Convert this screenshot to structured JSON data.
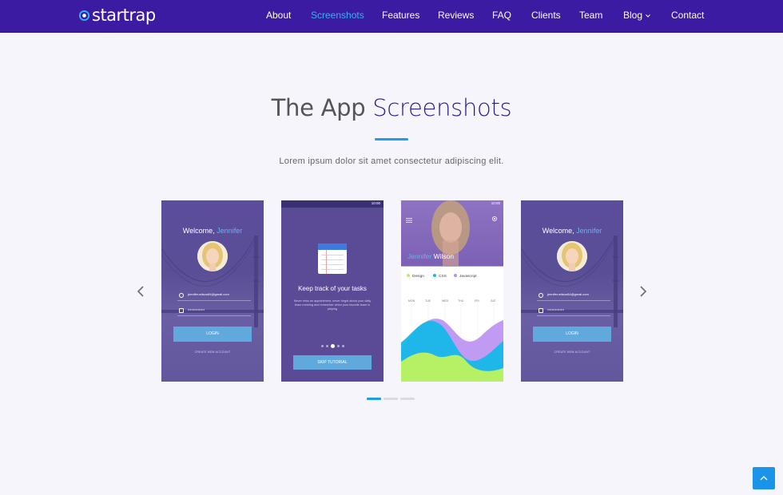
{
  "brand": {
    "name": "startrap",
    "accent": "#3b1ba2",
    "link_active": "#2fb5f0",
    "highlight": "#1a9fe8"
  },
  "nav": {
    "items": [
      {
        "label": "About",
        "active": false
      },
      {
        "label": "Screenshots",
        "active": true
      },
      {
        "label": "Features",
        "active": false
      },
      {
        "label": "Reviews",
        "active": false
      },
      {
        "label": "FAQ",
        "active": false
      },
      {
        "label": "Clients",
        "active": false
      },
      {
        "label": "Team",
        "active": false
      },
      {
        "label": "Blog",
        "active": false,
        "dropdown": true
      },
      {
        "label": "Contact",
        "active": false
      }
    ]
  },
  "section": {
    "title_light": "The App",
    "title_strong": "Screenshots",
    "subtitle": "Lorem ipsum dolor sit amet consectetur adipiscing elit."
  },
  "screens": {
    "login": {
      "welcome": "Welcome,",
      "name": "Jennifer",
      "email": "jennifer.wilson84@gmail.com",
      "password": "•••••••••••••••",
      "button": "LOGIN",
      "create": "CREATE NEW ACCOUNT"
    },
    "tutorial": {
      "time": "10:00",
      "title": "Keep track of your tasks",
      "text": "Never miss an appointment, never forget about your daily team meeting and remember when your favorite team is playing",
      "button": "SKIP TUTORIAL",
      "active_step": 3,
      "total_steps": 5
    },
    "profile": {
      "time": "10:00",
      "first": "Jennifer",
      "last": "Wilson",
      "legend": [
        {
          "label": "Design",
          "color": "#b5f065"
        },
        {
          "label": "CSS",
          "color": "#16b8e8"
        },
        {
          "label": "Javascript",
          "color": "#b98ff2"
        }
      ],
      "days": [
        "MON",
        "TUE",
        "WED",
        "THU",
        "FRI",
        "SAT"
      ]
    }
  },
  "carousel": {
    "pages": 3,
    "active_page": 1
  },
  "icons": {
    "prev": "chevron-left-icon",
    "next": "chevron-right-icon",
    "to_top": "chevron-up-icon",
    "blog_dropdown": "chevron-down-icon"
  }
}
